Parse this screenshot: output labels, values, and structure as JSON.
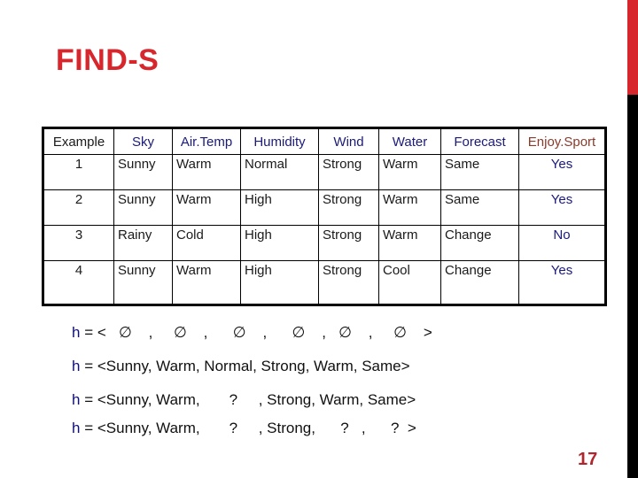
{
  "slide": {
    "title": "FIND-S",
    "page_number": "17",
    "accent_color": "#d7262c"
  },
  "table": {
    "headers": [
      "Example",
      "Sky",
      "Air.Temp",
      "Humidity",
      "Wind",
      "Water",
      "Forecast",
      "Enjoy.Sport"
    ],
    "rows": [
      [
        "1",
        "Sunny",
        "Warm",
        "Normal",
        "Strong",
        "Warm",
        "Same",
        "Yes"
      ],
      [
        "2",
        "Sunny",
        "Warm",
        "High",
        "Strong",
        "Warm",
        "Same",
        "Yes"
      ],
      [
        "3",
        "Rainy",
        "Cold",
        "High",
        "Strong",
        "Warm",
        "Change",
        "No"
      ],
      [
        "4",
        "Sunny",
        "Warm",
        "High",
        "Strong",
        "Cool",
        "Change",
        "Yes"
      ]
    ]
  },
  "hypotheses": [
    {
      "var": "h",
      "text": " = <   ∅    ,     ∅    ,      ∅    ,      ∅    ,   ∅    ,     ∅    >"
    },
    {
      "var": "h",
      "text": " = <Sunny, Warm, Normal, Strong, Warm, Same>"
    },
    {
      "var": "h",
      "text": " = <Sunny, Warm,       ?     , Strong, Warm, Same>"
    },
    {
      "var": "h",
      "text": " = <Sunny, Warm,       ?     , Strong,      ?   ,      ?  >"
    }
  ]
}
